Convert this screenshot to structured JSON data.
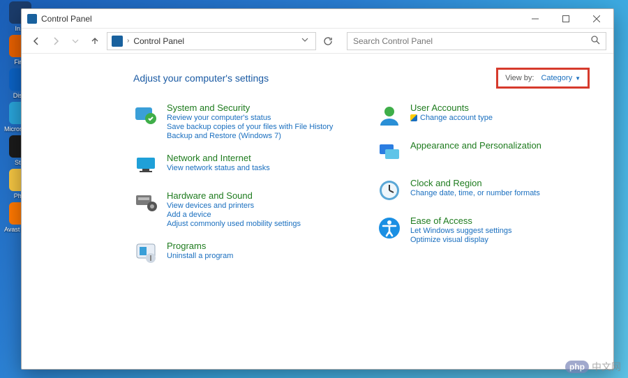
{
  "window": {
    "title": "Control Panel",
    "location": "Control Panel",
    "search_placeholder": "Search Control Panel"
  },
  "page": {
    "heading": "Adjust your computer's settings",
    "viewby_label": "View by:",
    "viewby_value": "Category"
  },
  "desktop_icons": [
    {
      "label": "In...",
      "color": "#1b3c6b"
    },
    {
      "label": "Fir...",
      "color": "#e66000"
    },
    {
      "label": "Dis...",
      "color": "#0b62c4"
    },
    {
      "label": "Microsoft Ed...",
      "color": "#29a4da"
    },
    {
      "label": "St...",
      "color": "#1b1b1b"
    },
    {
      "label": "Ph...",
      "color": "#f5c542"
    },
    {
      "label": "Avast Antivi...",
      "color": "#ff7800"
    }
  ],
  "categories_left": [
    {
      "name": "System and Security",
      "icon": "system-security-icon",
      "icon_bg": "#2a8fd6",
      "subs": [
        {
          "label": "Review your computer's status",
          "shield": false
        },
        {
          "label": "Save backup copies of your files with File History",
          "shield": false
        },
        {
          "label": "Backup and Restore (Windows 7)",
          "shield": false
        }
      ]
    },
    {
      "name": "Network and Internet",
      "icon": "network-internet-icon",
      "icon_bg": "#1fa0d8",
      "subs": [
        {
          "label": "View network status and tasks",
          "shield": false
        }
      ]
    },
    {
      "name": "Hardware and Sound",
      "icon": "hardware-sound-icon",
      "icon_bg": "#6b6b6b",
      "subs": [
        {
          "label": "View devices and printers",
          "shield": false
        },
        {
          "label": "Add a device",
          "shield": false
        },
        {
          "label": "Adjust commonly used mobility settings",
          "shield": false
        }
      ]
    },
    {
      "name": "Programs",
      "icon": "programs-icon",
      "icon_bg": "#cfd8e3",
      "subs": [
        {
          "label": "Uninstall a program",
          "shield": false
        }
      ]
    }
  ],
  "categories_right": [
    {
      "name": "User Accounts",
      "icon": "user-accounts-icon",
      "icon_bg": "#3fae49",
      "subs": [
        {
          "label": "Change account type",
          "shield": true
        }
      ]
    },
    {
      "name": "Appearance and Personalization",
      "icon": "appearance-icon",
      "icon_bg": "#2b7de1",
      "subs": []
    },
    {
      "name": "Clock and Region",
      "icon": "clock-region-icon",
      "icon_bg": "#5aa7d6",
      "subs": [
        {
          "label": "Change date, time, or number formats",
          "shield": false
        }
      ]
    },
    {
      "name": "Ease of Access",
      "icon": "ease-access-icon",
      "icon_bg": "#1a8fe3",
      "subs": [
        {
          "label": "Let Windows suggest settings",
          "shield": false
        },
        {
          "label": "Optimize visual display",
          "shield": false
        }
      ]
    }
  ],
  "watermark": "中文网"
}
